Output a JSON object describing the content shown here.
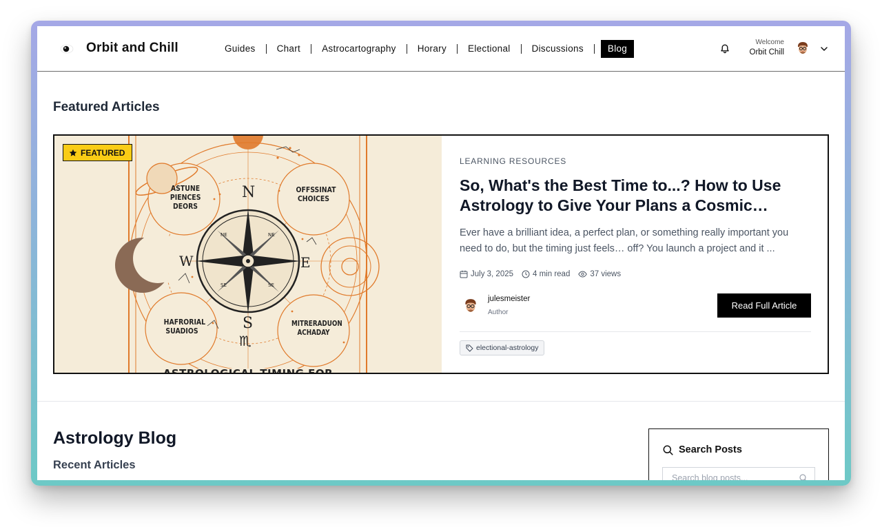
{
  "header": {
    "brand": "Orbit and Chill",
    "nav": [
      {
        "label": "Guides"
      },
      {
        "label": "Chart"
      },
      {
        "label": "Astrocartography"
      },
      {
        "label": "Horary"
      },
      {
        "label": "Electional"
      },
      {
        "label": "Discussions"
      },
      {
        "label": "Blog",
        "active": true
      }
    ],
    "welcome_label": "Welcome",
    "user_name": "Orbit Chill",
    "icons": [
      "logo-icon",
      "bell-icon",
      "chevron-down-icon"
    ]
  },
  "featured": {
    "heading": "Featured Articles",
    "badge": "FEATURED",
    "image": {
      "words_top_left": [
        "ASTUNE",
        "PIENCES",
        "DEORS"
      ],
      "words_top_right": [
        "OFFSSINAT",
        "CHOICES"
      ],
      "words_bottom_left": [
        "HAFRORIAL",
        "SUADIOS"
      ],
      "words_bottom_right": [
        "MITRERADUON",
        "ACHADAY"
      ],
      "bottom_banner": "ASTROLOGICAL TIMING FOR",
      "compass_letters": {
        "n": "N",
        "s": "S",
        "e": "E",
        "w": "W"
      },
      "compass_minor": {
        "ne": "NE",
        "nw": "NE",
        "se": "SE",
        "sw": "SE"
      },
      "zodiac_glyphs": {
        "top": "♎",
        "bottom": "♏"
      }
    },
    "category": "LEARNING RESOURCES",
    "title": "So, What's the Best Time to...? How to Use Astrology to Give Your Plans a Cosmic…",
    "excerpt": "Ever have a brilliant idea, a perfect plan, or something really important you need to do, but the timing just feels… off? You launch a project and it ...",
    "date": "July 3, 2025",
    "read_time": "4 min read",
    "views": "37 views",
    "author_name": "julesmeister",
    "author_role": "Author",
    "cta": "Read Full Article",
    "tag": "electional-astrology"
  },
  "blog": {
    "heading": "Astrology Blog",
    "recent_heading": "Recent Articles"
  },
  "search": {
    "title": "Search Posts",
    "placeholder": "Search blog posts..."
  },
  "colors": {
    "accent_badge": "#facc15",
    "image_bg": "#f5ecd9",
    "image_orange": "#e07a2b",
    "button_bg": "#000000",
    "frame_top": "#a5a8e6",
    "frame_bottom": "#6dc9c6"
  }
}
